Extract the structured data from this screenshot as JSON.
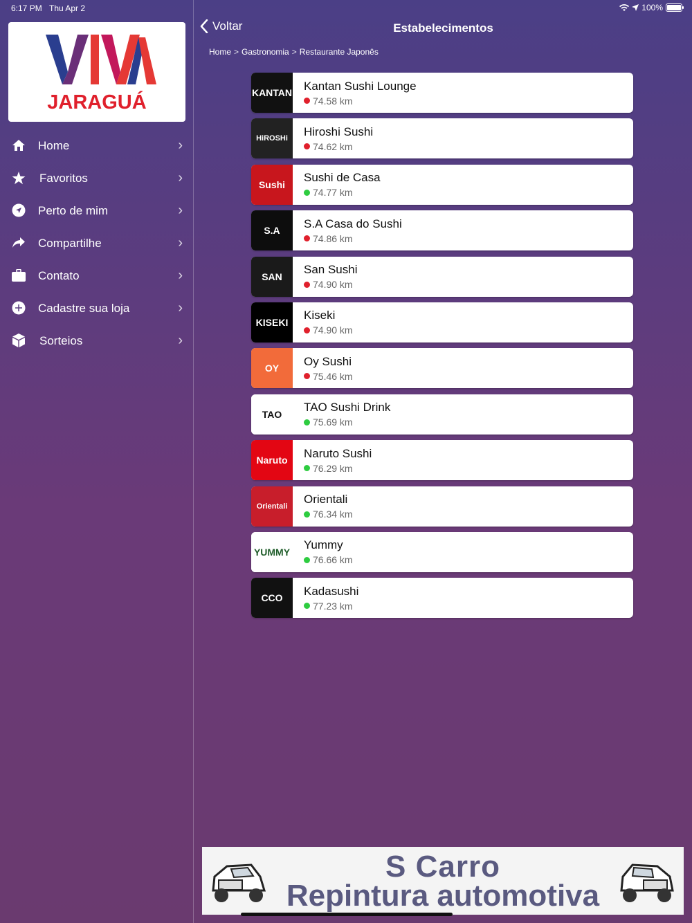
{
  "status": {
    "time": "6:17 PM",
    "date": "Thu Apr 2",
    "battery": "100%"
  },
  "logo": {
    "brand": "VIVA",
    "city": "JARAGUÁ"
  },
  "menu": [
    {
      "label": "Home",
      "icon": "house-icon"
    },
    {
      "label": "Favoritos",
      "icon": "star-icon"
    },
    {
      "label": "Perto de mim",
      "icon": "location-icon"
    },
    {
      "label": "Compartilhe",
      "icon": "share-icon"
    },
    {
      "label": "Contato",
      "icon": "briefcase-icon"
    },
    {
      "label": "Cadastre sua loja",
      "icon": "plus-circle-icon"
    },
    {
      "label": "Sorteios",
      "icon": "box-icon"
    }
  ],
  "header": {
    "back_label": "Voltar",
    "title": "Estabelecimentos"
  },
  "breadcrumb": [
    "Home",
    "Gastronomia",
    "Restaurante Japonês"
  ],
  "breadcrumb_sep": ">",
  "colors": {
    "open": "#2ecc40",
    "closed": "#e0202c"
  },
  "establishments": [
    {
      "name": "Kantan Sushi Lounge",
      "distance": "74.58 km",
      "status": "closed",
      "thumb_text": "KANTAN",
      "thumb_bg": "#111111",
      "thumb_fg": "#ffffff"
    },
    {
      "name": "Hiroshi Sushi",
      "distance": "74.62 km",
      "status": "closed",
      "thumb_text": "HiROSHi",
      "thumb_bg": "#222222",
      "thumb_fg": "#ffffff"
    },
    {
      "name": "Sushi de Casa",
      "distance": "74.77 km",
      "status": "open",
      "thumb_text": "Sushi",
      "thumb_bg": "#c8161d",
      "thumb_fg": "#ffffff"
    },
    {
      "name": "S.A Casa do Sushi",
      "distance": "74.86 km",
      "status": "closed",
      "thumb_text": "S.A",
      "thumb_bg": "#0d0d0d",
      "thumb_fg": "#ffffff"
    },
    {
      "name": "San Sushi",
      "distance": "74.90 km",
      "status": "closed",
      "thumb_text": "SAN",
      "thumb_bg": "#1a1a1a",
      "thumb_fg": "#ffffff"
    },
    {
      "name": "Kiseki",
      "distance": "74.90 km",
      "status": "closed",
      "thumb_text": "KISEKI",
      "thumb_bg": "#000000",
      "thumb_fg": "#ffffff"
    },
    {
      "name": "Oy Sushi",
      "distance": "75.46 km",
      "status": "closed",
      "thumb_text": "OY",
      "thumb_bg": "#f26b3a",
      "thumb_fg": "#ffffff"
    },
    {
      "name": "TAO Sushi Drink",
      "distance": "75.69 km",
      "status": "open",
      "thumb_text": "TAO",
      "thumb_bg": "#ffffff",
      "thumb_fg": "#111111"
    },
    {
      "name": "Naruto Sushi",
      "distance": "76.29 km",
      "status": "open",
      "thumb_text": "Naruto",
      "thumb_bg": "#e30613",
      "thumb_fg": "#ffffff"
    },
    {
      "name": "Orientali",
      "distance": "76.34 km",
      "status": "open",
      "thumb_text": "Orientali",
      "thumb_bg": "#c81e2b",
      "thumb_fg": "#ffffff"
    },
    {
      "name": "Yummy",
      "distance": "76.66 km",
      "status": "open",
      "thumb_text": "YUMMY",
      "thumb_bg": "#ffffff",
      "thumb_fg": "#1f5d2a"
    },
    {
      "name": "Kadasushi",
      "distance": "77.23 km",
      "status": "open",
      "thumb_text": "CCO",
      "thumb_bg": "#111111",
      "thumb_fg": "#ffffff"
    }
  ],
  "banner": {
    "line1": "S Carro",
    "line2": "Repintura automotiva"
  }
}
